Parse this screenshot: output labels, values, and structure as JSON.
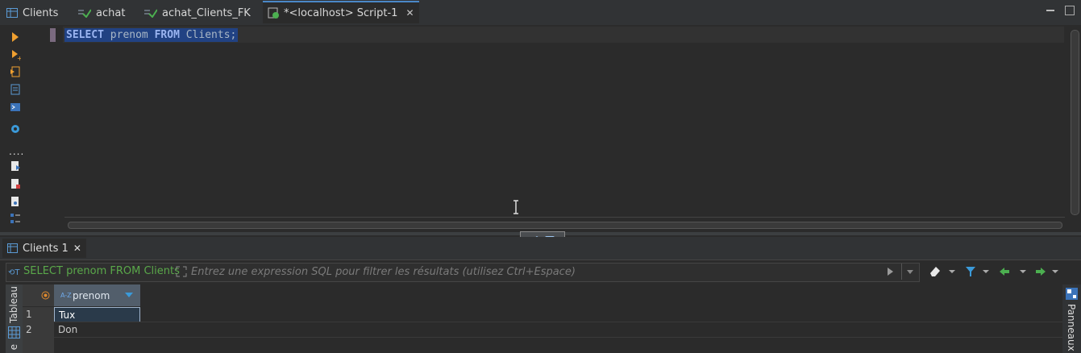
{
  "tabs": [
    {
      "label": "Clients",
      "icon": "table-icon"
    },
    {
      "label": "achat",
      "icon": "check-sql-icon"
    },
    {
      "label": "achat_Clients_FK",
      "icon": "check-sql-icon"
    },
    {
      "label": "*<localhost> Script-1",
      "icon": "script-icon",
      "active": true
    }
  ],
  "editor": {
    "sql_keyword1": "SELECT",
    "sql_ident1": " prenom ",
    "sql_keyword2": "FROM",
    "sql_ident2": " Clients;"
  },
  "results": {
    "tab_label": "Clients 1",
    "filter_sql": "SELECT prenom FROM Clients",
    "filter_placeholder": "Entrez une expression SQL pour filtrer les résultats (utilisez Ctrl+Espace)",
    "side_tab": "Tableau",
    "side_tab2": "e",
    "right_panel": "Panneaux",
    "column_type": "A-Z",
    "column": "prenom",
    "rows": [
      {
        "num": "1",
        "prenom": "Tux"
      },
      {
        "num": "2",
        "prenom": "Don"
      }
    ]
  },
  "colors": {
    "accent": "#4a88c7",
    "selection": "#214283",
    "filter_green": "#5aa84a"
  }
}
